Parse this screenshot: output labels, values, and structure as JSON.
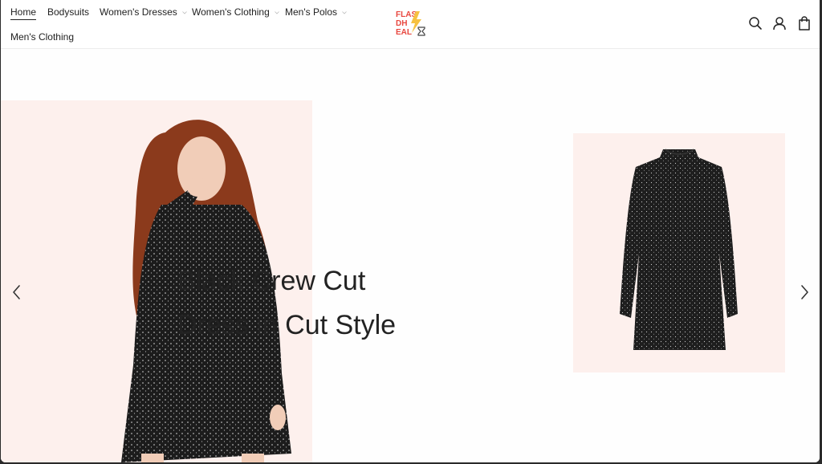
{
  "nav": {
    "items": [
      {
        "label": "Home",
        "active": true,
        "dropdown": false
      },
      {
        "label": "Bodysuits",
        "active": false,
        "dropdown": false
      },
      {
        "label": "Women's Dresses",
        "active": false,
        "dropdown": true
      },
      {
        "label": "Women's Clothing",
        "active": false,
        "dropdown": true
      },
      {
        "label": "Men's Polos",
        "active": false,
        "dropdown": true
      },
      {
        "label": "Men's Clothing",
        "active": false,
        "dropdown": false
      }
    ]
  },
  "logo": {
    "line1": "FLAS",
    "line2": "DH",
    "line3": "EAL",
    "colors": {
      "text": "#e8473f",
      "bolt": "#f6c141",
      "timer": "#444444"
    }
  },
  "header_icons": [
    "search-icon",
    "account-icon",
    "cart-icon"
  ],
  "hero": {
    "headline_line1": "Black Crew Cut",
    "headline_line2": "Dress in Cut Style",
    "panel_color": "#fdf0ed",
    "prev_icon": "chevron-left-icon",
    "next_icon": "chevron-right-icon"
  }
}
